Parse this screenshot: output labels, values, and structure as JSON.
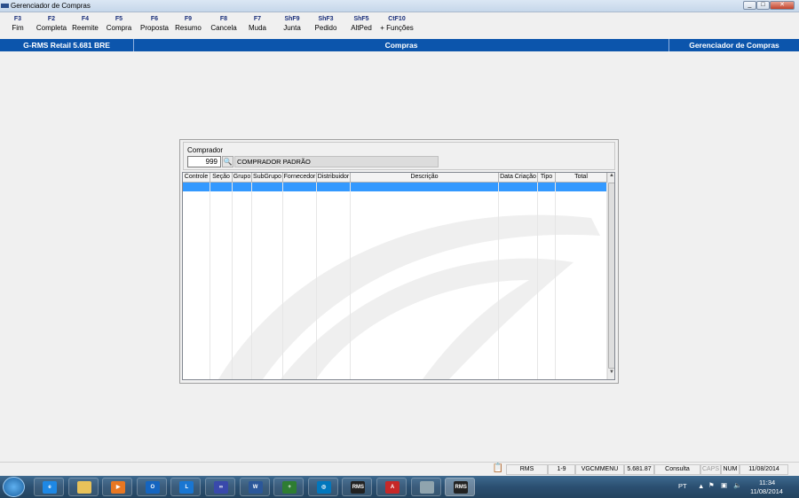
{
  "window": {
    "title": "Gerenciador de Compras",
    "controls": [
      "minimize",
      "maximize",
      "close"
    ]
  },
  "toolbar": [
    {
      "key": "F3",
      "label": "Fim"
    },
    {
      "key": "F2",
      "label": "Completa"
    },
    {
      "key": "F4",
      "label": "Reemite"
    },
    {
      "key": "F5",
      "label": "Compra"
    },
    {
      "key": "F6",
      "label": "Proposta"
    },
    {
      "key": "F9",
      "label": "Resumo"
    },
    {
      "key": "F8",
      "label": "Cancela"
    },
    {
      "key": "F7",
      "label": "Muda"
    },
    {
      "key": "ShF9",
      "label": "Junta"
    },
    {
      "key": "ShF3",
      "label": "Pedido"
    },
    {
      "key": "ShF5",
      "label": "AltPed"
    },
    {
      "key": "CtF10",
      "label": "+ Funções"
    }
  ],
  "header": {
    "product": "G-RMS Retail 5.681 BRE",
    "module": "Compras",
    "screen": "Gerenciador de Compras"
  },
  "comprador": {
    "label": "Comprador",
    "code": "999",
    "name": "COMPRADOR PADRÃO"
  },
  "table": {
    "columns": [
      "Controle",
      "Seção",
      "Grupo",
      "SubGrupo",
      "Fornecedor",
      "Distribuidor",
      "Descrição",
      "Data Criação",
      "Tipo",
      "Total"
    ],
    "rows": []
  },
  "status": [
    "RMS",
    "1-9",
    "VGCMMENU",
    "5.681.87",
    "Consulta",
    "CAPS",
    "NUM",
    "11/08/2014"
  ],
  "tray": {
    "lang": "PT",
    "time": "11:34",
    "date": "11/08/2014"
  },
  "taskbar": [
    {
      "name": "internet-explorer",
      "color": "#1e88e5",
      "text": "e"
    },
    {
      "name": "file-explorer",
      "color": "#e8c25a",
      "text": ""
    },
    {
      "name": "media-player",
      "color": "#e87722",
      "text": "▶"
    },
    {
      "name": "outlook",
      "color": "#1565c0",
      "text": "O"
    },
    {
      "name": "lync",
      "color": "#1976d2",
      "text": "L"
    },
    {
      "name": "app",
      "color": "#3949ab",
      "text": "∞"
    },
    {
      "name": "word",
      "color": "#2b579a",
      "text": "W"
    },
    {
      "name": "app-plus",
      "color": "#2e7d32",
      "text": "+"
    },
    {
      "name": "app-globe",
      "color": "#0277bd",
      "text": "◎"
    },
    {
      "name": "rms",
      "color": "#222",
      "text": "RMS"
    },
    {
      "name": "acrobat",
      "color": "#c62828",
      "text": "A"
    },
    {
      "name": "app-doc",
      "color": "#90a4ae",
      "text": ""
    },
    {
      "name": "rms-active",
      "color": "#222",
      "text": "RMS"
    }
  ]
}
